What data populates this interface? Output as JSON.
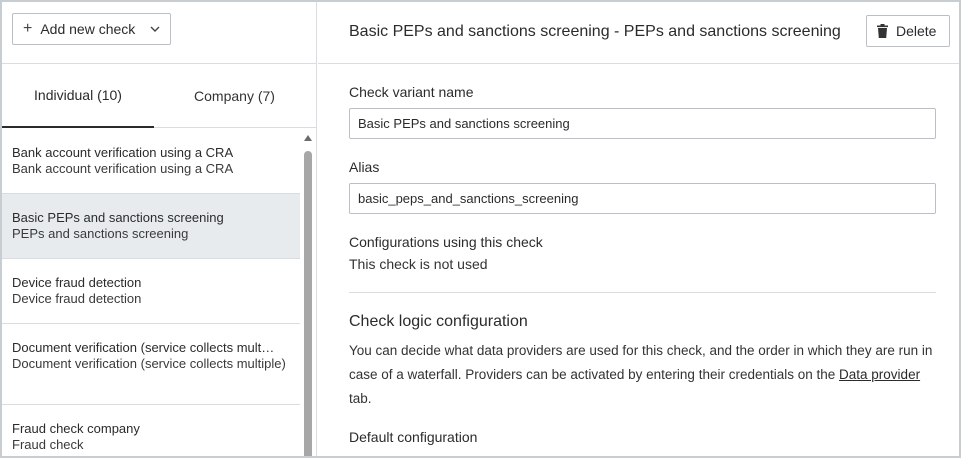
{
  "toolbar": {
    "add_label": "Add new check"
  },
  "tabs": [
    {
      "label": "Individual (10)",
      "active": true
    },
    {
      "label": "Company (7)",
      "active": false
    }
  ],
  "checks": [
    {
      "title": "Bank account verification using a CRA",
      "subtitle": "Bank account verification using a CRA"
    },
    {
      "title": "Basic PEPs and sanctions screening",
      "subtitle": "PEPs and sanctions screening",
      "selected": true
    },
    {
      "title": "Device fraud detection",
      "subtitle": "Device fraud detection"
    },
    {
      "title": "Document verification (service collects mult…",
      "subtitle": "Document verification (service collects multiple)"
    },
    {
      "title": "Fraud check company",
      "subtitle": "Fraud check"
    }
  ],
  "header": {
    "title": "Basic PEPs and sanctions screening - PEPs and sanctions screening",
    "delete_label": "Delete"
  },
  "form": {
    "variant_label": "Check variant name",
    "variant_value": "Basic PEPs and sanctions screening",
    "alias_label": "Alias",
    "alias_value": "basic_peps_and_sanctions_screening",
    "configs_label": "Configurations using this check",
    "configs_value": "This check is not used"
  },
  "logic": {
    "title": "Check logic configuration",
    "desc_before": "You can decide what data providers are used for this check, and the order in which they are run in case of a waterfall. Providers can be activated by entering their credentials on the ",
    "link_text": "Data provider",
    "desc_after": " tab.",
    "default_title": "Default configuration"
  },
  "colors": {
    "selected_bg": "#e8ebee",
    "border": "#d9dde1",
    "text": "#2b2b2b"
  }
}
